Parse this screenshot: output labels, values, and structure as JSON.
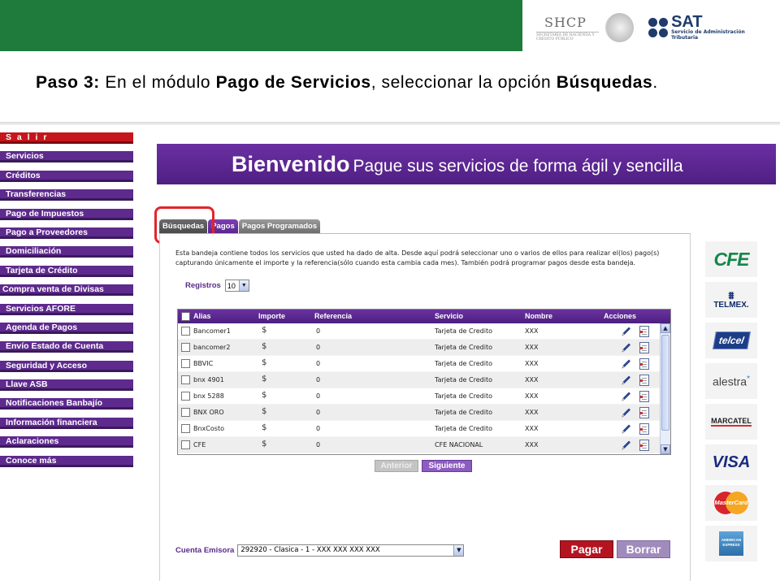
{
  "header": {
    "shcp_title": "SHCP",
    "shcp_subtitle": "SECRETARÍA DE HACIENDA Y CRÉDITO PÚBLICO",
    "sat_title": "SAT",
    "sat_subtitle": "Servicio de Administración Tributaria"
  },
  "instruction": {
    "step": "Paso 3:",
    "text1": " En el módulo ",
    "module": "Pago de Servicios",
    "text2": ", seleccionar la opción ",
    "option": "Búsquedas",
    "text3": "."
  },
  "sidebar": {
    "items": [
      {
        "label": "S a l i r"
      },
      {
        "label": "Servicios"
      },
      {
        "label": "Créditos"
      },
      {
        "label": "Transferencias"
      },
      {
        "label": "Pago de Impuestos"
      },
      {
        "label": "Pago a Proveedores"
      },
      {
        "label": "Domiciliación"
      },
      {
        "label": "Tarjeta de Crédito"
      },
      {
        "label": "Compra venta de Divisas"
      },
      {
        "label": "Servicios AFORE"
      },
      {
        "label": "Agenda de Pagos"
      },
      {
        "label": "Envío Estado de Cuenta"
      },
      {
        "label": "Seguridad y Acceso"
      },
      {
        "label": "Llave ASB"
      },
      {
        "label": "Notificaciones Banbajío"
      },
      {
        "label": "Información financiera"
      },
      {
        "label": "Aclaraciones"
      },
      {
        "label": "Conoce más"
      }
    ]
  },
  "banner": {
    "title": "Bienvenido",
    "subtitle": "Pague sus servicios de forma ágil y sencilla"
  },
  "tabs": [
    {
      "label": "Búsquedas"
    },
    {
      "label": "Pagos"
    },
    {
      "label": "Pagos Programados"
    }
  ],
  "main": {
    "description": "Esta bandeja contiene todos los servicios que usted ha dado de alta. Desde aquí podrá seleccionar uno o varios de ellos para realizar el(los) pago(s) capturando únicamente el importe y la referencia(sólo cuando esta cambia cada mes). También podrá programar pagos desde esta bandeja.",
    "registros_label": "Registros",
    "registros_value": "10",
    "columns": [
      "Alias",
      "Importe",
      "Referencia",
      "Servicio",
      "Nombre",
      "Acciones"
    ],
    "rows": [
      {
        "alias": "Bancomer1",
        "importe": "$",
        "referencia": "0",
        "servicio": "Tarjeta de Credito",
        "nombre": "XXX"
      },
      {
        "alias": "bancomer2",
        "importe": "$",
        "referencia": "0",
        "servicio": "Tarjeta de Credito",
        "nombre": "XXX"
      },
      {
        "alias": "BBVIC",
        "importe": "$",
        "referencia": "0",
        "servicio": "Tarjeta de Credito",
        "nombre": "XXX"
      },
      {
        "alias": "bnx 4901",
        "importe": "$",
        "referencia": "0",
        "servicio": "Tarjeta de Credito",
        "nombre": "XXX"
      },
      {
        "alias": "bnx 5288",
        "importe": "$",
        "referencia": "0",
        "servicio": "Tarjeta de Credito",
        "nombre": "XXX"
      },
      {
        "alias": "BNX ORO",
        "importe": "$",
        "referencia": "0",
        "servicio": "Tarjeta de Credito",
        "nombre": "XXX"
      },
      {
        "alias": "BnxCosto",
        "importe": "$",
        "referencia": "0",
        "servicio": "Tarjeta de Credito",
        "nombre": "XXX"
      },
      {
        "alias": "CFE",
        "importe": "$",
        "referencia": "0",
        "servicio": "CFE NACIONAL",
        "nombre": "XXX"
      }
    ],
    "prev_label": "Anterior",
    "next_label": "Siguiente",
    "cuenta_label": "Cuenta Emisora",
    "cuenta_value": "292920 - Clasica - 1 - XXX XXX XXX XXX",
    "pagar_label": "Pagar",
    "borrar_label": "Borrar"
  },
  "logos": {
    "cfe": "CFE",
    "telmex": "TELMEX.",
    "telcel": "telcel",
    "alestra": "alestra",
    "marcatel": "MARCATEL",
    "visa": "VISA",
    "mastercard": "MasterCard",
    "amex": "AMERICAN EXPRESS"
  },
  "colors": {
    "header_green": "#1e7b3c",
    "menu_purple": "#5e2a8e",
    "salir_red": "#c4161c",
    "highlight_red": "#e3242b",
    "pagar_red": "#b41420"
  }
}
